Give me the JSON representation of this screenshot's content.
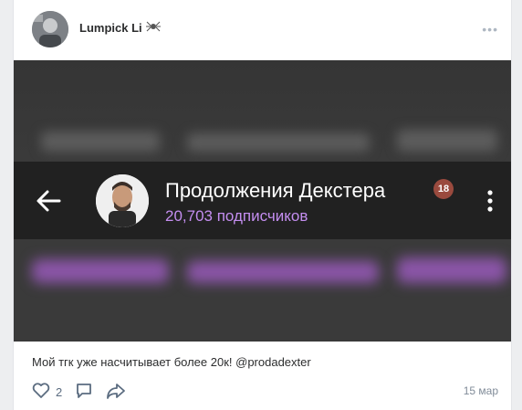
{
  "post": {
    "author": "Lumpick Li",
    "author_badge_icon": "spider-icon",
    "text": "Мой тгк уже насчитывает более 20к! @prodadexter",
    "likes": "2",
    "date": "15 мар"
  },
  "media": {
    "channel_title": "Продолжения Декстера",
    "subscribers": "20,703 подписчиков",
    "age_badge": "18"
  },
  "colors": {
    "page_bg": "#edeef0",
    "card_bg": "#ffffff",
    "tg_bar": "#212121",
    "subscribers_text": "#c48ef0",
    "action_icon": "#5b6c80"
  }
}
